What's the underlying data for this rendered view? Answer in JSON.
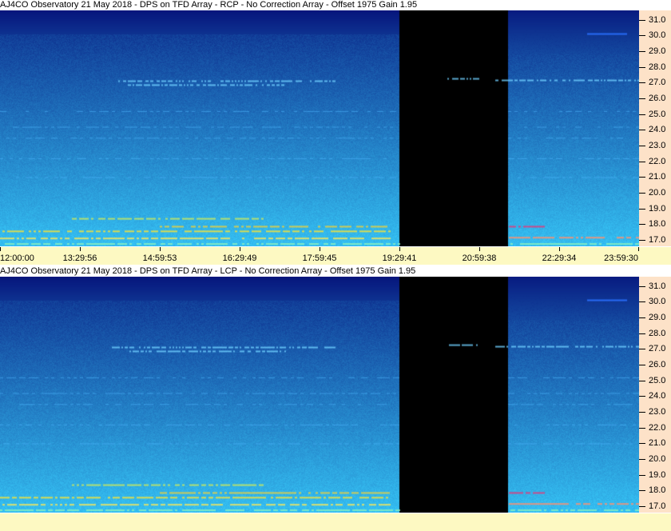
{
  "panels": [
    {
      "title": "AJ4CO Observatory 21 May 2018 - DPS on TFD Array  - RCP  -  No Correction Array  -  Offset 1975  Gain 1.95",
      "polarization": "RCP"
    },
    {
      "title": "AJ4CO Observatory 21 May 2018 - DPS on TFD Array  - LCP  -  No Correction Array  -  Offset 1975  Gain 1.95",
      "polarization": "LCP"
    }
  ],
  "freq_ticks": [
    "31.0",
    "30.0",
    "29.0",
    "28.0",
    "27.0",
    "26.0",
    "25.0",
    "24.0",
    "23.0",
    "22.0",
    "21.0",
    "20.0",
    "19.0",
    "18.0",
    "17.0"
  ],
  "freq_range_mhz": [
    16.6,
    31.6
  ],
  "time_ticks": [
    "12:00:00",
    "13:29:56",
    "14:59:53",
    "16:29:49",
    "17:59:45",
    "19:29:41",
    "20:59:38",
    "22:29:34",
    "23:59:30"
  ],
  "time_range": [
    "12:00:00",
    "23:59:30"
  ],
  "data_gap": {
    "start": "19:29:41",
    "end": "21:32:00"
  },
  "colors": {
    "freq_axis_bg": "#fde2c8",
    "time_axis_bg": "#fdf9c2",
    "gap": "#000000",
    "spectrogram_low": "#05127a",
    "spectrogram_high": "#3ad2ff",
    "emission_band": "#f0e040"
  }
}
